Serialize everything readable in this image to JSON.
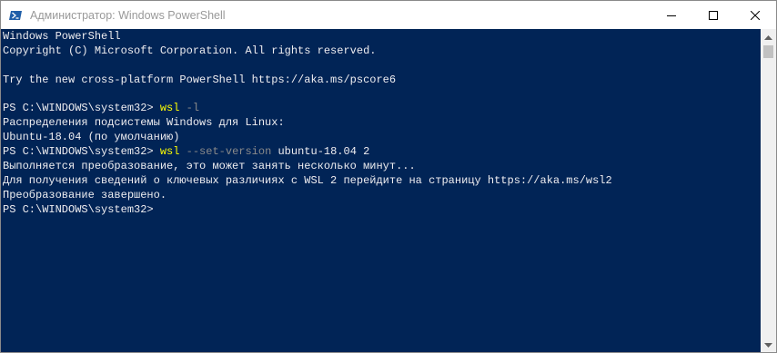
{
  "window": {
    "title": "Администратор: Windows PowerShell",
    "buttons": {
      "minimize": "minimize-icon",
      "maximize": "maximize-icon",
      "close": "close-icon"
    },
    "icon": "powershell-icon"
  },
  "colors": {
    "console_bg": "#012456",
    "console_text": "#eeedf0",
    "command": "#ffff00",
    "argument": "#8a8a8a"
  },
  "console": {
    "banner_1": "Windows PowerShell",
    "banner_2": "Copyright (C) Microsoft Corporation. All rights reserved.",
    "banner_3": "Try the new cross-platform PowerShell https://aka.ms/pscore6",
    "prompt": "PS C:\\WINDOWS\\system32>",
    "cmd1_name": "wsl",
    "cmd1_args": "-l",
    "out1_1": "Распределения подсистемы Windows для Linux:",
    "out1_2": "Ubuntu-18.04 (по умолчанию)",
    "cmd2_name": "wsl",
    "cmd2_flag": "--set-version",
    "cmd2_rest": "ubuntu-18.04 2",
    "out2_1": "Выполняется преобразование, это может занять несколько минут...",
    "out2_2": "Для получения сведений о ключевых различиях с WSL 2 перейдите на страницу https://aka.ms/wsl2",
    "out2_3": "Преобразование завершено."
  }
}
